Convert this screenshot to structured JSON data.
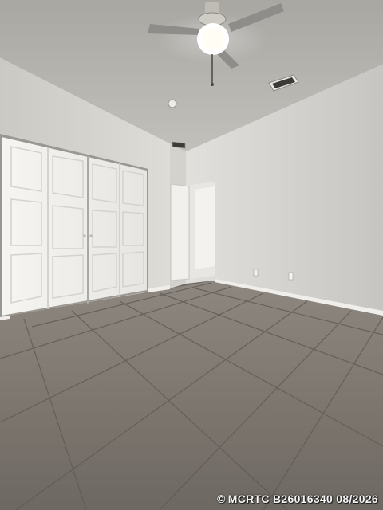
{
  "photo": {
    "subject": "empty-bedroom-interior",
    "features": [
      "ceiling-fan-with-light",
      "hvac-vent",
      "bifold-closet-doors",
      "open-interior-door",
      "tile-floor",
      "white-baseboards"
    ],
    "colors": {
      "ceiling": "#b4b2ad",
      "wall_left": "#d9d7d2",
      "wall_right": "#cfcdc9",
      "floor": "#7a746d",
      "grout": "#5e5852",
      "door": "#f2f1ee"
    }
  },
  "watermark": {
    "copyright_symbol": "©",
    "text": "MCRTC B26016340 08/2026"
  }
}
